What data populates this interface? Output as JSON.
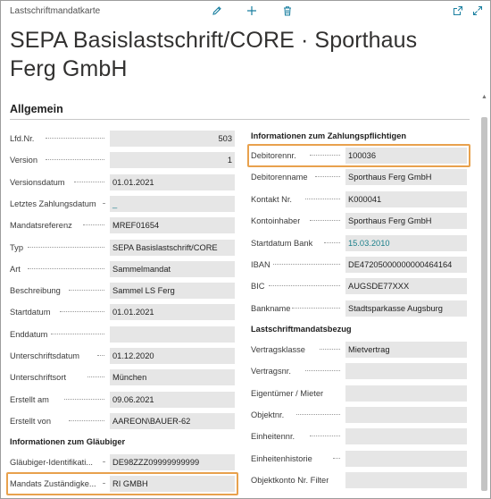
{
  "window": {
    "caption": "Lastschriftmandatkarte",
    "title": "SEPA Basislastschrift/CORE · Sporthaus Ferg GmbH"
  },
  "toolbar": {
    "edit_icon": "pencil-icon",
    "new_icon": "plus-icon",
    "delete_icon": "trash-icon",
    "popout_icon": "popout-icon",
    "expand_icon": "expand-icon",
    "accent_color": "#1a7fa0"
  },
  "general": {
    "heading": "Allgemein",
    "left_fields": [
      {
        "label": "Lfd.Nr.",
        "value": "503",
        "align": "right"
      },
      {
        "label": "Version",
        "value": "1",
        "align": "right"
      },
      {
        "label": "Versionsdatum",
        "value": "01.01.2021"
      },
      {
        "label": "Letztes Zahlungsdatum",
        "value": "_",
        "link": true
      },
      {
        "label": "Mandatsreferenz",
        "value": "MREF01654"
      },
      {
        "label": "Typ",
        "value": "SEPA Basislastschrift/CORE"
      },
      {
        "label": "Art",
        "value": "Sammelmandat"
      },
      {
        "label": "Beschreibung",
        "value": "Sammel LS Ferg"
      },
      {
        "label": "Startdatum",
        "value": "01.01.2021"
      },
      {
        "label": "Enddatum",
        "value": ""
      },
      {
        "label": "Unterschriftsdatum",
        "value": "01.12.2020"
      },
      {
        "label": "Unterschriftsort",
        "value": "München"
      },
      {
        "label": "Erstellt am",
        "value": "09.06.2021"
      },
      {
        "label": "Erstellt von",
        "value": "AAREON\\BAUER-62"
      }
    ],
    "creditor_heading": "Informationen zum Gläubiger",
    "creditor_fields": [
      {
        "label": "Gläubiger-Identifikati...",
        "value": "DE98ZZZ09999999999"
      },
      {
        "label": "Mandats Zuständigke...",
        "value": "RI GMBH",
        "highlight": true
      }
    ],
    "payer_heading": "Informationen zum Zahlungspflichtigen",
    "payer_fields": [
      {
        "label": "Debitorennr.",
        "value": "100036",
        "highlight": true
      },
      {
        "label": "Debitorenname",
        "value": "Sporthaus Ferg GmbH"
      },
      {
        "label": "Kontakt Nr.",
        "value": "K000041"
      },
      {
        "label": "Kontoinhaber",
        "value": "Sporthaus Ferg GmbH"
      },
      {
        "label": "Startdatum Bank",
        "value": "15.03.2010",
        "link": true
      },
      {
        "label": "IBAN",
        "value": "DE47205000000000464164"
      },
      {
        "label": "BIC",
        "value": "AUGSDE77XXX"
      },
      {
        "label": "Bankname",
        "value": "Stadtsparkasse Augsburg"
      }
    ],
    "mandate_heading": "Lastschriftmandatsbezug",
    "mandate_fields": [
      {
        "label": "Vertragsklasse",
        "value": "Mietvertrag"
      },
      {
        "label": "Vertragsnr.",
        "value": ""
      },
      {
        "label": "Eigentümer / Mieter",
        "value": ""
      },
      {
        "label": "Objektnr.",
        "value": ""
      },
      {
        "label": "Einheitennr.",
        "value": ""
      },
      {
        "label": "Einheitenhistorie",
        "value": ""
      },
      {
        "label": "Objektkonto Nr. Filter",
        "value": ""
      }
    ]
  }
}
